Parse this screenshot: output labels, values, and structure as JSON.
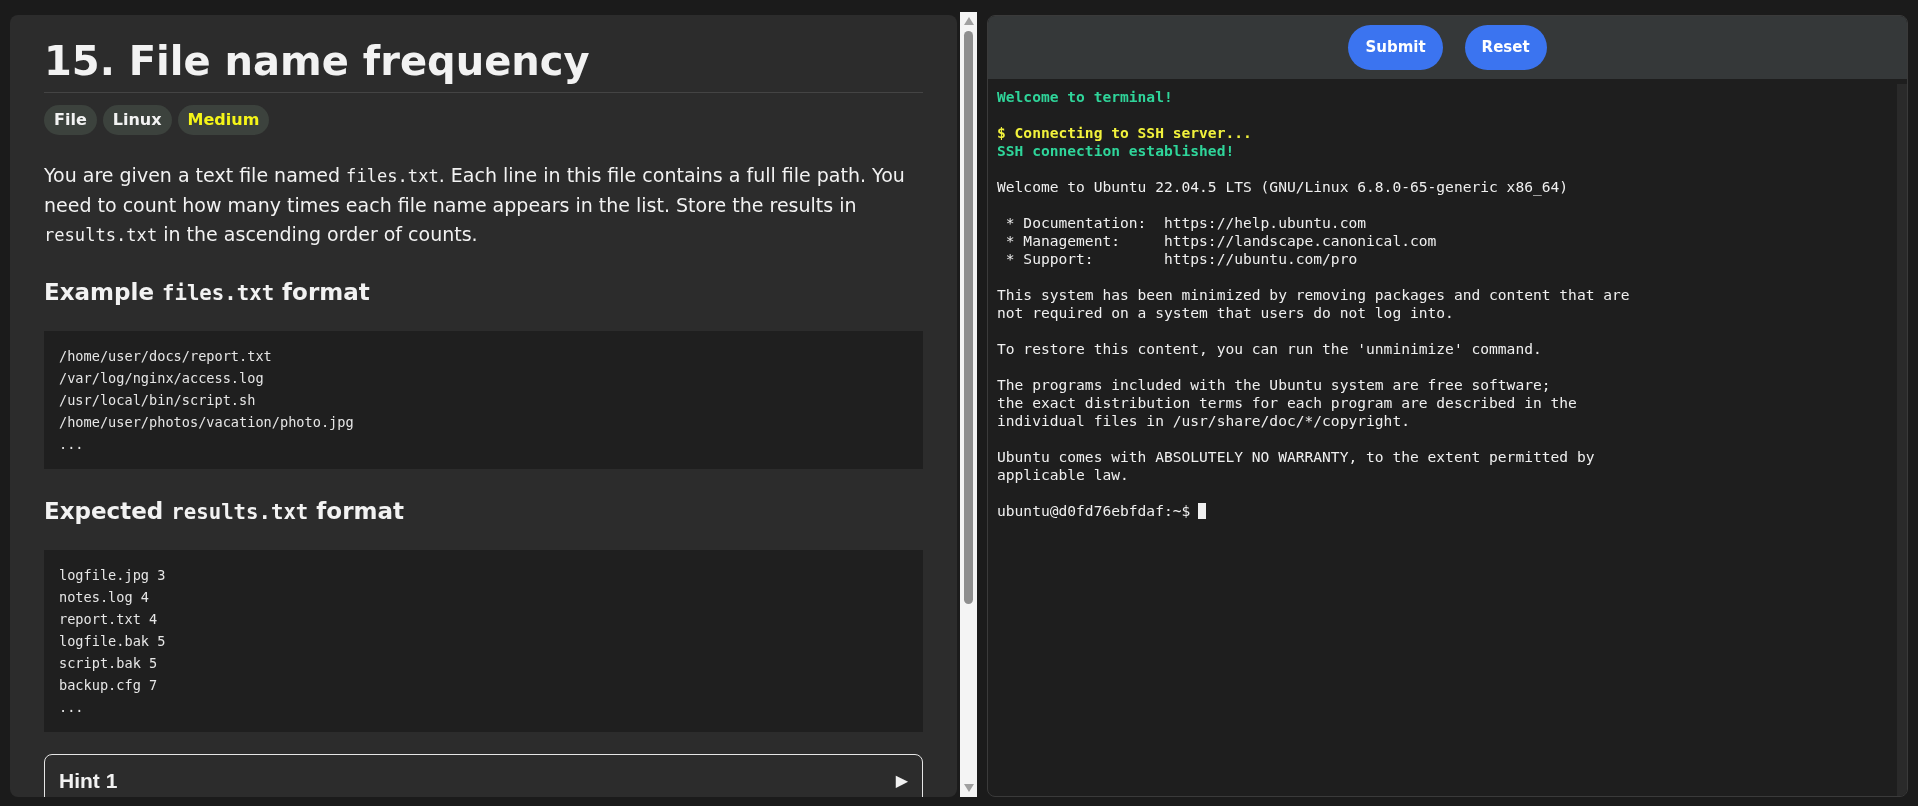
{
  "problem": {
    "title": "15. File name frequency",
    "tags": [
      {
        "label": "File",
        "kind": "topic"
      },
      {
        "label": "Linux",
        "kind": "topic"
      },
      {
        "label": "Medium",
        "kind": "difficulty"
      }
    ],
    "description": [
      {
        "text": "You are given a text file named ",
        "kind": "text"
      },
      {
        "text": "files.txt",
        "kind": "code"
      },
      {
        "text": ". Each line in this file contains a full file path. You need to count how many times each file name appears in the list. Store the results in ",
        "kind": "text"
      },
      {
        "text": "results.txt",
        "kind": "code"
      },
      {
        "text": " in the ascending order of counts.",
        "kind": "text"
      }
    ],
    "sections": [
      {
        "heading": [
          {
            "text": "Example ",
            "kind": "text"
          },
          {
            "text": "files.txt",
            "kind": "code"
          },
          {
            "text": " format",
            "kind": "text"
          }
        ],
        "code": [
          "/home/user/docs/report.txt",
          "/var/log/nginx/access.log",
          "/usr/local/bin/script.sh",
          "/home/user/photos/vacation/photo.jpg",
          "..."
        ]
      },
      {
        "heading": [
          {
            "text": "Expected ",
            "kind": "text"
          },
          {
            "text": "results.txt",
            "kind": "code"
          },
          {
            "text": " format",
            "kind": "text"
          }
        ],
        "code": [
          "logfile.jpg 3",
          "notes.log 4",
          "report.txt 4",
          "logfile.bak 5",
          "script.bak 5",
          "backup.cfg 7",
          "..."
        ]
      }
    ],
    "hints": [
      {
        "title": "Hint 1",
        "toggle": "▶",
        "expanded": false
      }
    ]
  },
  "toolbar": {
    "buttons": [
      "Submit",
      "Reset"
    ]
  },
  "terminal": {
    "paragraphs": [
      {
        "lines": [
          {
            "text": "Welcome to terminal!",
            "kind": "success"
          }
        ]
      },
      {
        "lines": [
          {
            "text": "$ Connecting to SSH server...",
            "kind": "command"
          },
          {
            "text": "SSH connection established!",
            "kind": "success"
          }
        ]
      },
      {
        "lines": [
          {
            "text": "Welcome to Ubuntu 22.04.5 LTS (GNU/Linux 6.8.0-65-generic x86_64)",
            "kind": "output"
          }
        ]
      },
      {
        "lines": [
          {
            "text": " * Documentation:  https://help.ubuntu.com",
            "kind": "output"
          },
          {
            "text": " * Management:     https://landscape.canonical.com",
            "kind": "output"
          },
          {
            "text": " * Support:        https://ubuntu.com/pro",
            "kind": "output"
          }
        ]
      },
      {
        "lines": [
          {
            "text": "This system has been minimized by removing packages and content that are",
            "kind": "output"
          },
          {
            "text": "not required on a system that users do not log into.",
            "kind": "output"
          }
        ]
      },
      {
        "lines": [
          {
            "text": "To restore this content, you can run the 'unminimize' command.",
            "kind": "output"
          }
        ]
      },
      {
        "lines": [
          {
            "text": "The programs included with the Ubuntu system are free software;",
            "kind": "output"
          },
          {
            "text": "the exact distribution terms for each program are described in the",
            "kind": "output"
          },
          {
            "text": "individual files in /usr/share/doc/*/copyright.",
            "kind": "output"
          }
        ]
      },
      {
        "lines": [
          {
            "text": "Ubuntu comes with ABSOLUTELY NO WARRANTY, to the extent permitted by",
            "kind": "output"
          },
          {
            "text": "applicable law.",
            "kind": "output"
          }
        ]
      }
    ],
    "prompt": "ubuntu@d0fd76ebfdaf:~$"
  }
}
